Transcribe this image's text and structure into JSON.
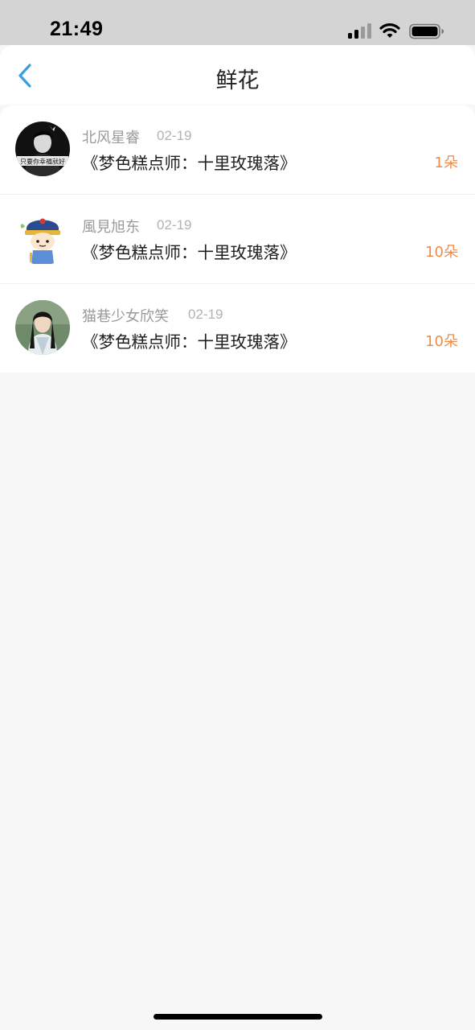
{
  "status_bar": {
    "time": "21:49",
    "icons": [
      "signal-icon",
      "wifi-icon",
      "battery-icon"
    ]
  },
  "header": {
    "title": "鲜花",
    "back_icon": "chevron-left-icon"
  },
  "colors": {
    "accent_back": "#3a9fdd",
    "count": "#ee8c4a",
    "username": "#9a9a9a",
    "date": "#b3b3b3",
    "book": "#1f1f1f",
    "background": "#f7f7f7"
  },
  "items": [
    {
      "user": "北风星睿",
      "date": "02-19",
      "book": "《梦色糕点师：十里玫瑰落》",
      "count": "1朵",
      "avatar_caption": "只要你幸福就好"
    },
    {
      "user": "風見旭东",
      "date": "02-19",
      "book": "《梦色糕点师：十里玫瑰落》",
      "count": "10朵"
    },
    {
      "user": "猫巷少女欣笑",
      "date": "02-19",
      "book": "《梦色糕点师：十里玫瑰落》",
      "count": "10朵"
    }
  ]
}
